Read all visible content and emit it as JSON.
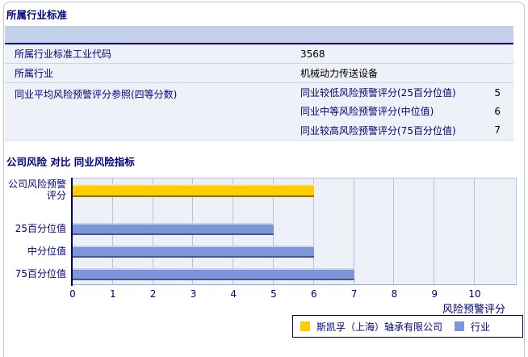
{
  "section1": {
    "title": "所属行业标准",
    "table": {
      "rows": [
        {
          "label": "所属行业标准工业代码",
          "value": "3568"
        },
        {
          "label": "所属行业",
          "value": "机械动力传送设备"
        }
      ],
      "group_row": {
        "label": "同业平均风险预警评分参照(四等分数)",
        "subrows": [
          {
            "label": "同业较低风险预警评分(25百分位值)",
            "value": "5"
          },
          {
            "label": "同业中等风险预警评分(中位值)",
            "value": "6"
          },
          {
            "label": "同业较高风险预警评分(75百分位值)",
            "value": "7"
          }
        ]
      }
    }
  },
  "section2": {
    "title": "公司风险 对比 同业风险指标"
  },
  "chart_data": {
    "type": "bar",
    "orientation": "horizontal",
    "categories": [
      "公司风险预警评分",
      "25百分位值",
      "中分位值",
      "75百分位值"
    ],
    "series": [
      {
        "name": "斯凯孚（上海）轴承有限公司",
        "color": "#ffcc00",
        "values": [
          6,
          null,
          null,
          null
        ]
      },
      {
        "name": "行业",
        "color": "#7d96d9",
        "values": [
          null,
          5,
          6,
          7
        ]
      }
    ],
    "xlabel": "风险预警评分",
    "xlim": [
      0,
      11
    ],
    "xticks": [
      0,
      1,
      2,
      3,
      4,
      5,
      6,
      7,
      8,
      9,
      10
    ],
    "grid": true,
    "legend_position": "bottom-right",
    "colors": {
      "plot_background": "#edf0f7",
      "gridline": "#b6c3e6",
      "axis": "#000066",
      "text": "#000080",
      "table_header": "#c5d1e9",
      "row_background": "#eef1f8"
    }
  }
}
